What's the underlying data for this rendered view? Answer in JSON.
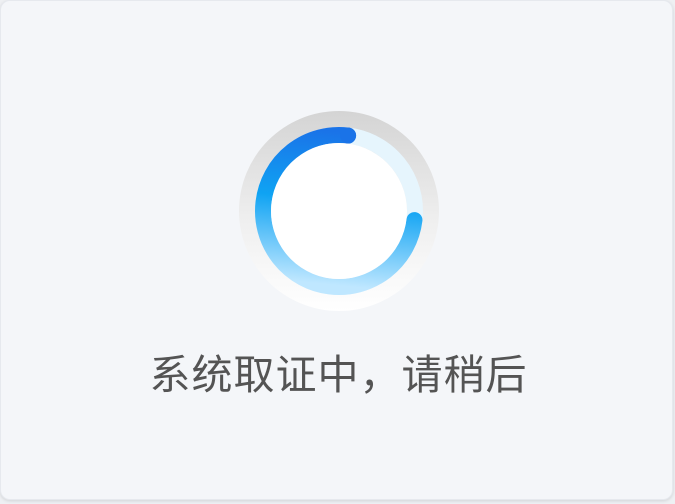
{
  "dialog": {
    "message": "系统取证中，请稍后"
  },
  "spinner": {
    "icon": "loading-spinner-icon",
    "progress": 0.75,
    "colors": {
      "arc_start": "#1a73e8",
      "arc_mid": "#0fa3f3",
      "arc_end": "#bfe7ff",
      "track": "#e8f6fd",
      "ring_outer_top": "#d6d6d6",
      "ring_outer_bottom": "#ffffff"
    }
  }
}
